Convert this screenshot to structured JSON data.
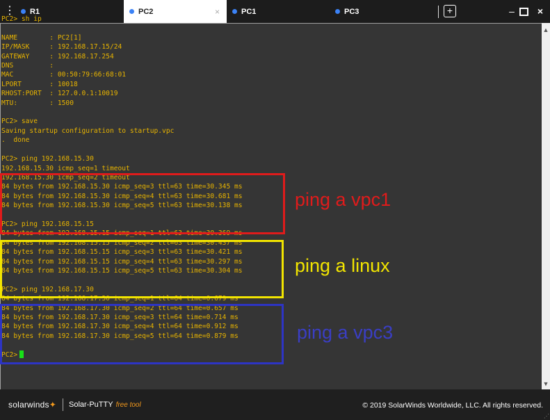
{
  "tabs": [
    {
      "label": "R1",
      "dot_color": "#3b82f6"
    },
    {
      "label": "PC2",
      "dot_color": "#3b82f6",
      "active": true
    },
    {
      "label": "PC1",
      "dot_color": "#3b82f6"
    },
    {
      "label": "PC3",
      "dot_color": "#3b82f6"
    }
  ],
  "tab_close": "×",
  "tab_add": "+",
  "window": {
    "minimize": "–",
    "close": "×"
  },
  "terminal": {
    "lines": [
      "PC2> sh ip",
      "",
      "NAME        : PC2[1]",
      "IP/MASK     : 192.168.17.15/24",
      "GATEWAY     : 192.168.17.254",
      "DNS         :",
      "MAC         : 00:50:79:66:68:01",
      "LPORT       : 10018",
      "RHOST:PORT  : 127.0.0.1:10019",
      "MTU:        : 1500",
      "",
      "PC2> save",
      "Saving startup configuration to startup.vpc",
      ".  done",
      "",
      "PC2> ping 192.168.15.30",
      "192.168.15.30 icmp_seq=1 timeout",
      "192.168.15.30 icmp_seq=2 timeout",
      "84 bytes from 192.168.15.30 icmp_seq=3 ttl=63 time=30.345 ms",
      "84 bytes from 192.168.15.30 icmp_seq=4 ttl=63 time=30.681 ms",
      "84 bytes from 192.168.15.30 icmp_seq=5 ttl=63 time=30.138 ms",
      "",
      "PC2> ping 192.168.15.15",
      "84 bytes from 192.168.15.15 icmp_seq=1 ttl=63 time=30.369 ms",
      "84 bytes from 192.168.15.15 icmp_seq=2 ttl=63 time=30.437 ms",
      "84 bytes from 192.168.15.15 icmp_seq=3 ttl=63 time=30.421 ms",
      "84 bytes from 192.168.15.15 icmp_seq=4 ttl=63 time=30.297 ms",
      "84 bytes from 192.168.15.15 icmp_seq=5 ttl=63 time=30.304 ms",
      "",
      "PC2> ping 192.168.17.30",
      "84 bytes from 192.168.17.30 icmp_seq=1 ttl=64 time=0.679 ms",
      "84 bytes from 192.168.17.30 icmp_seq=2 ttl=64 time=0.657 ms",
      "84 bytes from 192.168.17.30 icmp_seq=3 ttl=64 time=0.714 ms",
      "84 bytes from 192.168.17.30 icmp_seq=4 ttl=64 time=0.912 ms",
      "84 bytes from 192.168.17.30 icmp_seq=5 ttl=64 time=0.879 ms",
      "",
      "PC2>"
    ],
    "text_color": "#e8b400",
    "cursor_color": "#18e018",
    "background": "#353535"
  },
  "annotations": {
    "red": {
      "text": "ping a vpc1",
      "color": "#e01b1b"
    },
    "yellow": {
      "text": "ping a linux",
      "color": "#f2e500"
    },
    "blue": {
      "text": "ping a vpc3",
      "color": "#3a3ec4"
    }
  },
  "footer": {
    "brand": "solarwinds",
    "product": "Solar-PuTTY",
    "product_tag": "free tool",
    "copyright": "© 2019 SolarWinds Worldwide, LLC. All rights reserved."
  },
  "icons": [
    "menu-dots-icon",
    "tab-dot-icon",
    "close-icon",
    "add-tab-icon",
    "minimize-icon",
    "maximize-icon",
    "scroll-up-icon",
    "scroll-down-icon",
    "solarwinds-flame-icon"
  ]
}
